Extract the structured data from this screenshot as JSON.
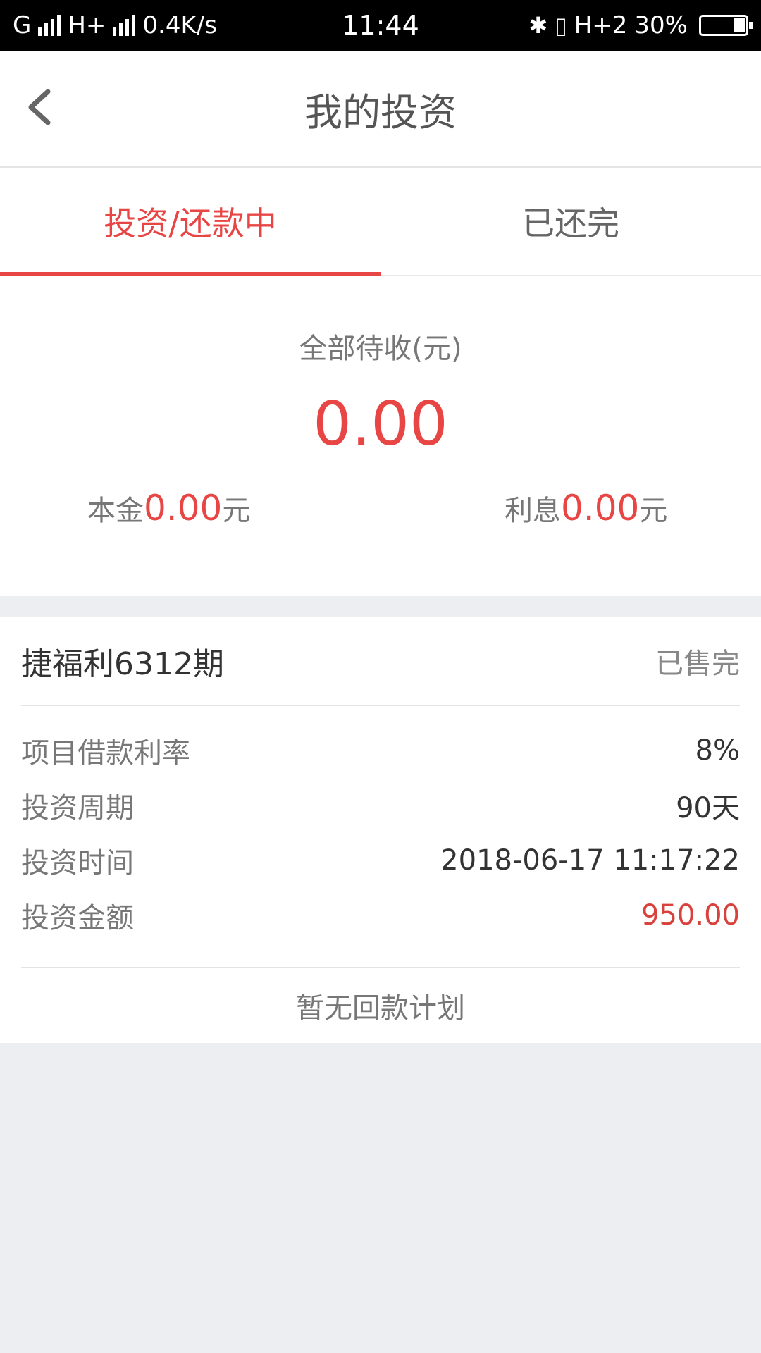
{
  "status_bar": {
    "network1": "G",
    "network2": "H+",
    "speed": "0.4K/s",
    "time": "11:44",
    "data_icon": "H+2",
    "battery": "30%"
  },
  "header": {
    "title": "我的投资"
  },
  "tabs": [
    {
      "label": "投资/还款中",
      "active": true
    },
    {
      "label": "已还完",
      "active": false
    }
  ],
  "summary": {
    "label": "全部待收(元)",
    "total": "0.00",
    "principal_label": "本金",
    "principal_value": "0.00",
    "interest_label": "利息",
    "interest_value": "0.00",
    "unit": "元"
  },
  "investment": {
    "title": "捷福利6312期",
    "status": "已售完",
    "rows": [
      {
        "key": "项目借款利率",
        "value": "8%"
      },
      {
        "key": "投资周期",
        "value": "90天"
      },
      {
        "key": "投资时间",
        "value": "2018-06-17 11:17:22"
      },
      {
        "key": "投资金额",
        "value": "950.00"
      }
    ],
    "footer": "暂无回款计划"
  },
  "colors": {
    "accent": "#e84645",
    "background": "#edeef2"
  }
}
